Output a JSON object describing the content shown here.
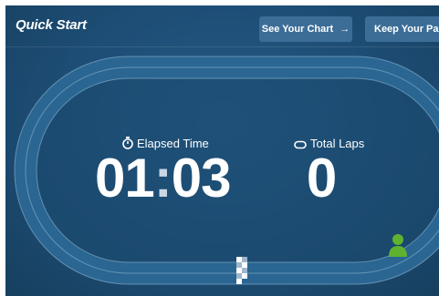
{
  "header": {
    "title": "Quick Start",
    "chart_button_label": "See Your Chart",
    "chart_button_icon": "arrow-right-icon",
    "pace_button_label": "Keep Your Pace"
  },
  "stats": {
    "elapsed_label": "Elapsed Time",
    "elapsed_icon": "stopwatch-icon",
    "elapsed_minutes": "01",
    "elapsed_separator": ":",
    "elapsed_seconds": "03",
    "laps_label": "Total Laps",
    "laps_icon": "loop-icon",
    "laps_value": "0"
  },
  "track": {
    "runner_icon": "runner-avatar-icon",
    "finish_line_icon": "checkered-finish-line",
    "runner_color": "#5fb22f",
    "track_color": "#2a6691",
    "lane_line_color": "#7fa8c8"
  }
}
